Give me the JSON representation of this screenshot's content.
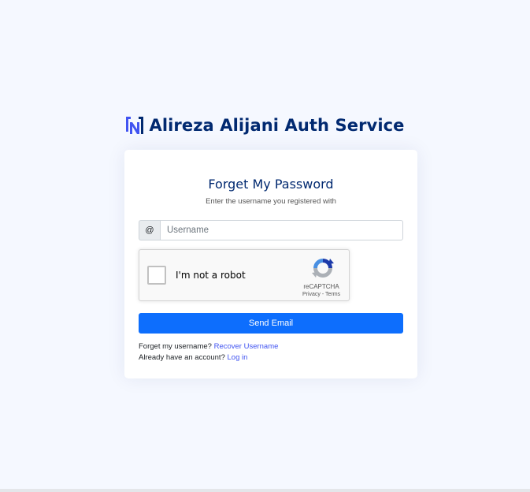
{
  "brand": {
    "name": "Alireza Alijani Auth Service",
    "logo_icon": "brand-logo-icon",
    "color": "#012970",
    "logo_color": "#4154f1"
  },
  "card": {
    "title": "Forget My Password",
    "subtitle": "Enter the username you registered with"
  },
  "username": {
    "prefix": "@",
    "placeholder": "Username",
    "value": ""
  },
  "recaptcha": {
    "label": "I'm not a robot",
    "brand": "reCAPTCHA",
    "privacy": "Privacy",
    "separator": " - ",
    "terms": "Terms",
    "checked": false
  },
  "send_button": {
    "label": "Send Email",
    "color": "#0d6efd"
  },
  "help": {
    "forgot_username_text": "Forget my username?",
    "forgot_username_link": "Recover Username",
    "have_account_text": "Already have an account?",
    "login_link": "Log in",
    "link_color": "#4154f1"
  }
}
